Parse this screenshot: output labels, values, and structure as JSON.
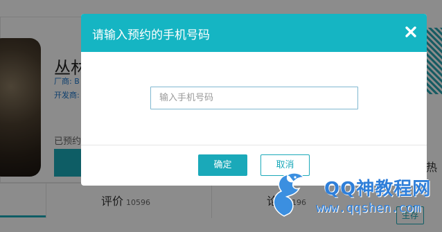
{
  "background": {
    "app_name": "丛林",
    "vendor_label": "厂商: B",
    "developer_label": "开发商:",
    "reserved_text": "已预约",
    "tabs": [
      {
        "label": "评价",
        "count": "10596"
      },
      {
        "label": "论坛",
        "count": "196"
      }
    ],
    "right_text": "热",
    "save_tag": "生存"
  },
  "watermark": {
    "title": "QQ神教程网",
    "url": "www.qqshen.com"
  },
  "modal": {
    "title": "请输入预约的手机号码",
    "close_icon": "close-icon",
    "input": {
      "value": "",
      "placeholder": "输入手机号码"
    },
    "confirm_label": "确定",
    "cancel_label": "取消"
  },
  "colors": {
    "accent": "#15b5c3",
    "button": "#1aa9b9",
    "watermark": "#2f7fd9"
  }
}
